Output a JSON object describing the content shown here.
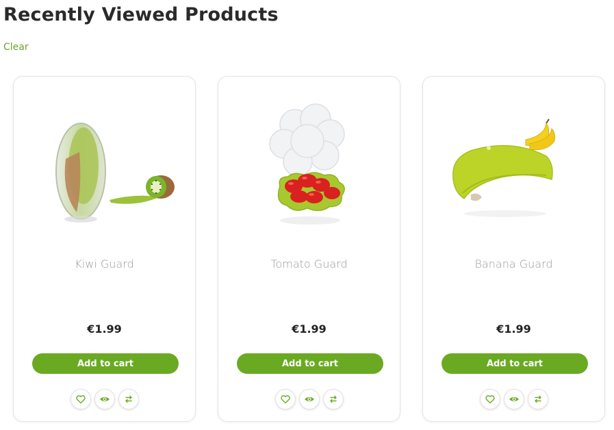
{
  "page": {
    "title": "Recently Viewed Products",
    "clear_label": "Clear"
  },
  "colors": {
    "accent": "#6aaa23",
    "link": "#6aa52a",
    "product_name": "#9a9a9a"
  },
  "products": [
    {
      "name": "Kiwi Guard",
      "price": "€1.99",
      "add_to_cart_label": "Add to cart",
      "image_icon": "kiwi-guard-image",
      "actions": [
        "wishlist-heart-icon",
        "quick-view-eye-icon",
        "compare-arrows-icon"
      ]
    },
    {
      "name": "Tomato Guard",
      "price": "€1.99",
      "add_to_cart_label": "Add to cart",
      "image_icon": "tomato-guard-image",
      "actions": [
        "wishlist-heart-icon",
        "quick-view-eye-icon",
        "compare-arrows-icon"
      ]
    },
    {
      "name": "Banana Guard",
      "price": "€1.99",
      "add_to_cart_label": "Add to cart",
      "image_icon": "banana-guard-image",
      "actions": [
        "wishlist-heart-icon",
        "quick-view-eye-icon",
        "compare-arrows-icon"
      ]
    }
  ]
}
